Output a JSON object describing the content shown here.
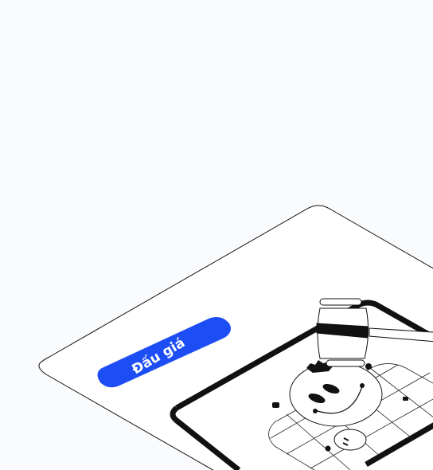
{
  "button": {
    "label": "Đấu giá",
    "color": "#1d4ef5"
  },
  "illustration": {
    "subject": "auction-gavel-smiley-icon"
  }
}
